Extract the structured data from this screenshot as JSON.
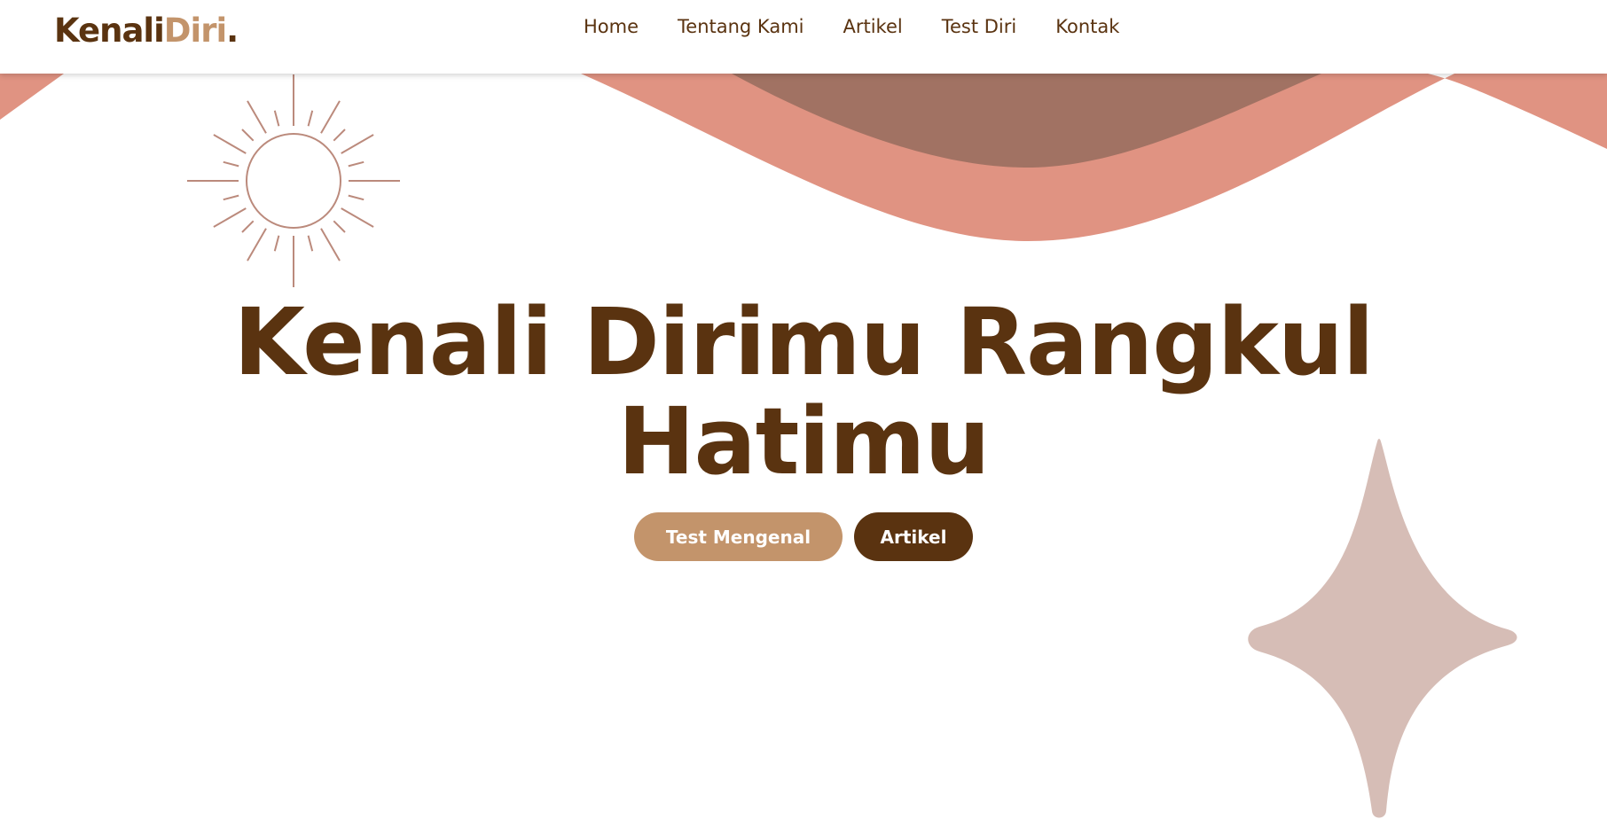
{
  "brand": {
    "part1": "Kenali",
    "part2": "Diri",
    "part3": "."
  },
  "nav": {
    "items": [
      {
        "label": "Home"
      },
      {
        "label": "Tentang Kami"
      },
      {
        "label": "Artikel"
      },
      {
        "label": "Test Diri"
      },
      {
        "label": "Kontak"
      }
    ]
  },
  "hero": {
    "title_line1": "Kenali Dirimu Rangkul",
    "title_line2": "Hatimu",
    "primary_button": "Test Mengenal",
    "secondary_button": "Artikel"
  },
  "colors": {
    "brand_dark": "#5a3310",
    "brand_light": "#c3946b",
    "wave_salmon": "#e09382",
    "wave_brown": "#a17263",
    "sparkle": "#d6bdb6",
    "sun_line": "#bb8a7c"
  },
  "icons": {
    "sun": "sun-line-icon",
    "sparkle": "four-point-star-icon"
  }
}
